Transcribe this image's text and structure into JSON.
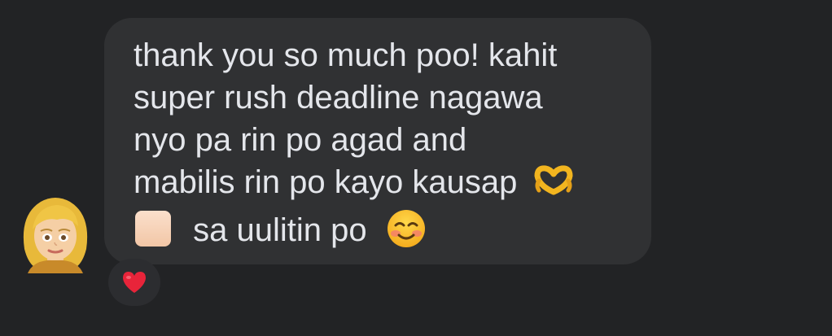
{
  "message": {
    "lines": [
      "thank you so much poo! kahit",
      "super rush deadline nagawa",
      "nyo pa rin po agad and",
      "mabilis rin po kayo kausap",
      "sa uulitin po"
    ],
    "emojis": [
      "heart-hands-emoji",
      "skin-tone-modifier-swatch",
      "smiling-face-with-smiling-eyes-emoji"
    ]
  },
  "sender": {
    "avatar": "memoji-blonde-woman-avatar"
  },
  "reaction": {
    "emoji": "red-heart-emoji"
  },
  "colors": {
    "background": "#222325",
    "bubble": "#303133",
    "text": "#e4e6eb",
    "reaction_pill": "#2c2d30",
    "heart": "#e8243a"
  }
}
